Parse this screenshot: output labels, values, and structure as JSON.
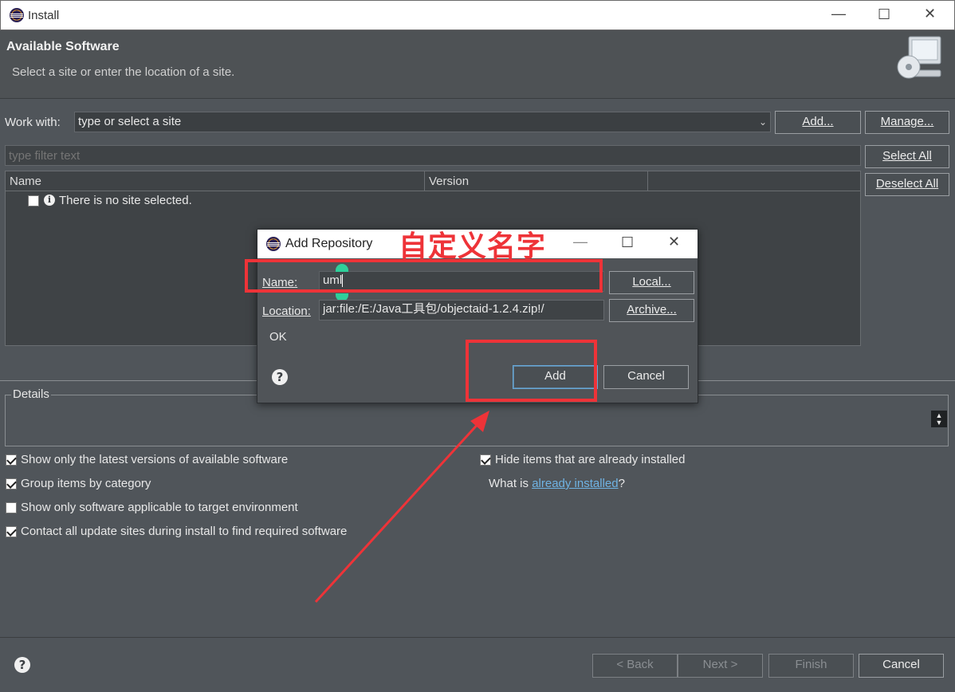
{
  "window": {
    "title": "Install"
  },
  "header": {
    "title": "Available Software",
    "subtitle": "Select a site or enter the location of a site."
  },
  "work_with": {
    "label": "Work with:",
    "value": "type or select a site",
    "add_button": "Add...",
    "manage_button": "Manage..."
  },
  "filter": {
    "placeholder": "type filter text"
  },
  "side_buttons": {
    "select_all": "Select All",
    "deselect_all": "Deselect All"
  },
  "table": {
    "columns": [
      "Name",
      "Version"
    ],
    "rows": [
      {
        "text": "There is no site selected.",
        "checked": false
      }
    ]
  },
  "details": {
    "label": "Details"
  },
  "options": {
    "latest_versions": {
      "label": "Show only the latest versions of available software",
      "checked": true
    },
    "group_by_category": {
      "label": "Group items by category",
      "checked": true
    },
    "target_env": {
      "label": "Show only software applicable to target environment",
      "checked": false
    },
    "contact_sites": {
      "label": "Contact all update sites during install to find required software",
      "checked": true
    },
    "hide_installed": {
      "label": "Hide items that are already installed",
      "checked": true
    },
    "what_is_prefix": "What is ",
    "what_is_link": "already installed",
    "what_is_suffix": "?"
  },
  "dialog": {
    "title": "Add Repository",
    "name_label": "Name:",
    "name_value": "uml",
    "location_label": "Location:",
    "location_value": "jar:file:/E:/Java工具包/objectaid-1.2.4.zip!/",
    "local_button": "Local...",
    "archive_button": "Archive...",
    "status": "OK",
    "add_button": "Add",
    "cancel_button": "Cancel"
  },
  "annotation": {
    "text": "自定义名字",
    "color": "#ee3338"
  },
  "footer": {
    "back": "< Back",
    "next": "Next >",
    "finish": "Finish",
    "cancel": "Cancel"
  },
  "icons": [
    "eclipse-icon",
    "info-icon",
    "help-icon",
    "monitor-cd-icon",
    "scroll-arrows-icon"
  ]
}
